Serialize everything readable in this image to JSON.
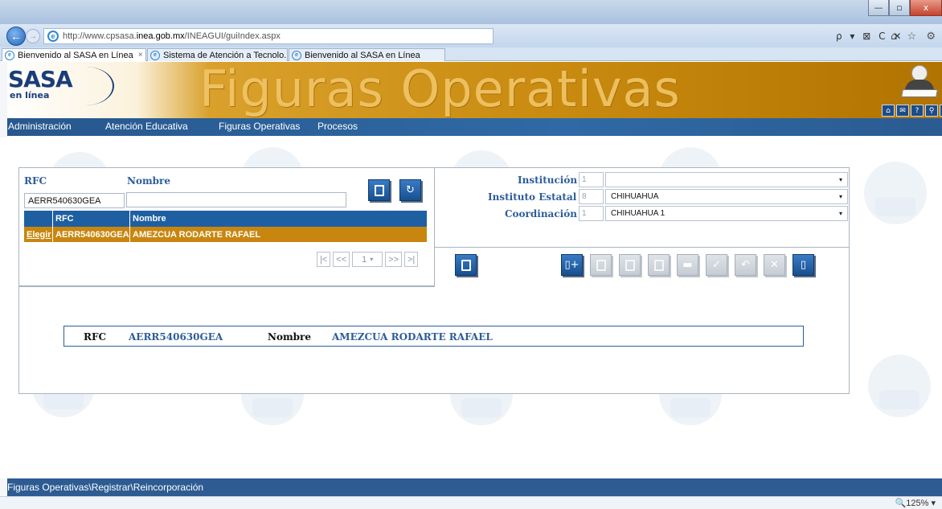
{
  "browser": {
    "url_prefix": "http://www.cpsasa.",
    "url_domain": "inea.gob.mx",
    "url_suffix": "/INEAGUI/guiIndex.aspx",
    "addr_tools": "ρ ▾ ⊠ C ✕",
    "right_icons": "⌂ ☆ ⚙",
    "win_min": "—",
    "win_max": "▫",
    "win_close": "x",
    "back_glyph": "←",
    "fwd_glyph": "→",
    "tabs": [
      {
        "label": "Bienvenido al SASA en Línea",
        "close": "×"
      },
      {
        "label": "Sistema de Atención a Tecnolo..."
      },
      {
        "label": "Bienvenido al SASA en Línea"
      }
    ],
    "zoom": "🔍125%  ▾"
  },
  "banner": {
    "logo_main": "SASA",
    "logo_sub": "en línea",
    "title": "Figuras Operativas",
    "top_icons": [
      "⌂",
      "✉",
      "?",
      "⚲",
      "?"
    ]
  },
  "menu": {
    "items": [
      "Administración",
      "Atención Educativa",
      "Figuras Operativas",
      "Procesos"
    ]
  },
  "search": {
    "rfc_label": "RFC",
    "nombre_label": "Nombre",
    "rfc_value": "AERR540630GEA",
    "nombre_value": ""
  },
  "grid": {
    "headers": [
      "",
      "RFC",
      "Nombre"
    ],
    "rows": [
      {
        "action": "Elegir",
        "rfc": "AERR540630GEA",
        "nombre": "AMEZCUA RODARTE RAFAEL"
      }
    ]
  },
  "pager": {
    "first": "|<",
    "prev": "<<",
    "page": "1",
    "page_arrow": "▾",
    "next": ">>",
    "last": ">|"
  },
  "filters": {
    "institucion_label": "Institución :",
    "institucion_code": "1",
    "institucion_value": "",
    "estatal_label": "Instituto Estatal :",
    "estatal_code": "8",
    "estatal_value": "CHIHUAHUA",
    "coordinacion_label": "Coordinación :",
    "coordinacion_code": "1",
    "coordinacion_value": "CHIHUAHUA 1",
    "arrow": "▾"
  },
  "toolbar": {
    "new_glyph": "▯+",
    "exit_glyph": "▯"
  },
  "selected": {
    "rfc_label": "RFC",
    "rfc_value": "AERR540630GEA",
    "nombre_label": "Nombre",
    "nombre_value": "AMEZCUA RODARTE RAFAEL"
  },
  "status": {
    "breadcrumb": "Figuras Operativas\\Registrar\\Reincorporación"
  }
}
